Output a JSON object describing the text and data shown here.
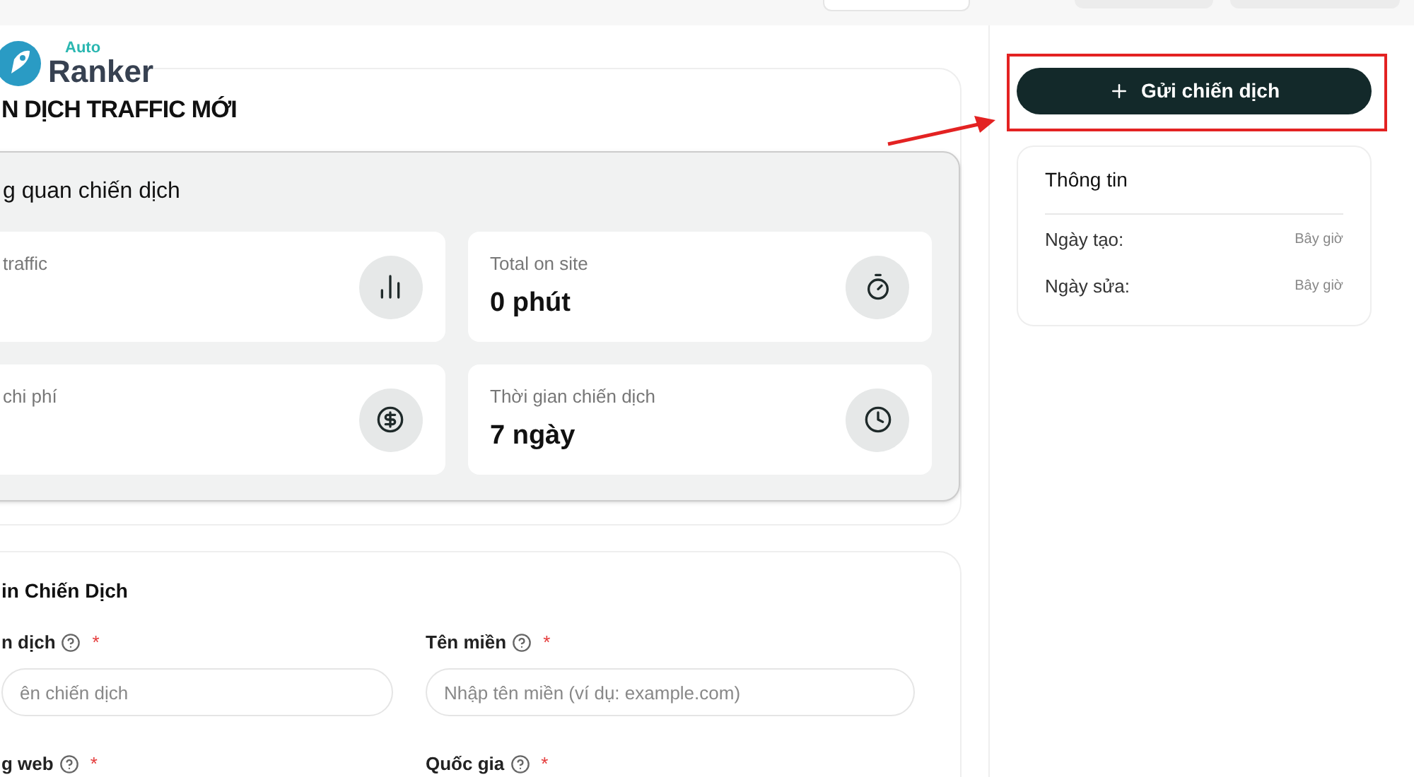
{
  "logo": {
    "small": "Auto",
    "large": "Ranker"
  },
  "page_title": "N DỊCH TRAFFIC MỚI",
  "overview": {
    "title": "g quan chiến dịch",
    "stats": [
      {
        "label": "traffic"
      },
      {
        "label": "Total on site",
        "value": "0 phút"
      },
      {
        "label": "chi phí"
      },
      {
        "label": "Thời gian chiến dịch",
        "value": "7 ngày"
      }
    ]
  },
  "info_section": {
    "title": "in Chiến Dịch",
    "fields": [
      {
        "label": "n dịch",
        "required_mark": "*",
        "placeholder": "ên chiến dịch"
      },
      {
        "label": "Tên miền",
        "required_mark": "*",
        "placeholder": "Nhập tên miền (ví dụ: example.com)"
      },
      {
        "label": "g web",
        "required_mark": "*"
      },
      {
        "label": "Quốc gia",
        "required_mark": "*"
      }
    ]
  },
  "submit_button": {
    "label": "Gửi chiến dịch",
    "highlighted": true
  },
  "info_card": {
    "title": "Thông tin",
    "rows": [
      {
        "label": "Ngày tạo:",
        "value": "Bây giờ"
      },
      {
        "label": "Ngày sửa:",
        "value": "Bây giờ"
      }
    ]
  }
}
